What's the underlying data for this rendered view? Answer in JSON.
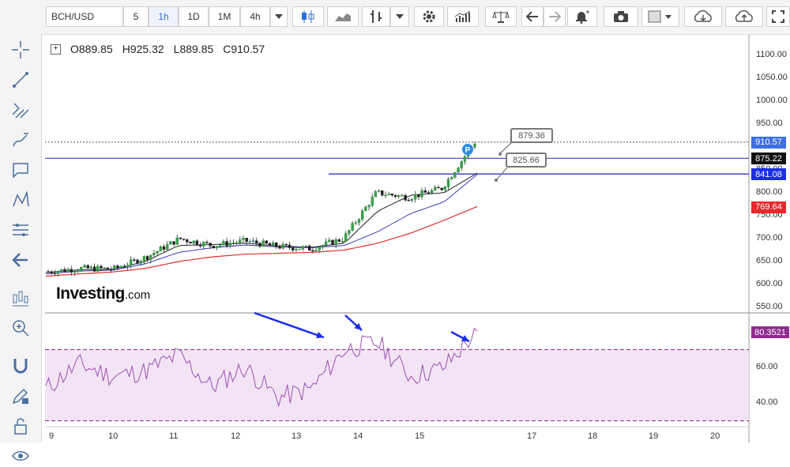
{
  "toolbar": {
    "symbol": "BCH/USD",
    "intervals": [
      "5",
      "1h",
      "1D",
      "1M",
      "4h"
    ],
    "active_interval": "1h",
    "icons": [
      "candlestick-icon",
      "area-chart-icon",
      "bar-chart-icon",
      "chevron-down-icon",
      "gear-icon",
      "indicators-icon",
      "balance-icon",
      "undo-icon",
      "redo-icon",
      "alert-bell-icon",
      "camera-icon",
      "color-picker-icon",
      "cloud-download-icon",
      "cloud-upload-icon",
      "fullscreen-icon"
    ]
  },
  "left_toolbar": {
    "icons": [
      "crosshair-icon",
      "trendline-icon",
      "fib-icon",
      "brush-icon",
      "comment-icon",
      "pattern-icon",
      "measure-icon",
      "back-arrow-icon",
      "indicators-icon",
      "zoom-icon",
      "magnet-icon",
      "pencil-lock-icon",
      "lock-icon",
      "eye-icon"
    ]
  },
  "ohlc": {
    "open": "O889.85",
    "high": "H925.32",
    "low": "L889.85",
    "close": "C910.57"
  },
  "logo": {
    "main": "Investing",
    "suffix": ".com"
  },
  "price_axis": {
    "labels": [
      "1100.00",
      "1050.00",
      "1000.00",
      "950.00",
      "900.00",
      "850.00",
      "800.00",
      "750.00",
      "700.00",
      "650.00",
      "600.00",
      "550.00"
    ],
    "values": [
      1100,
      1050,
      1000,
      950,
      900,
      850,
      800,
      750,
      700,
      650,
      600,
      550
    ],
    "tags": [
      {
        "label": "910.57",
        "value": 910.57,
        "color": "#3d6fe0"
      },
      {
        "label": "875.22",
        "value": 875.22,
        "color": "#111111"
      },
      {
        "label": "841.08",
        "value": 841.08,
        "color": "#1a2ee8"
      },
      {
        "label": "769.64",
        "value": 769.64,
        "color": "#e8262b"
      }
    ]
  },
  "rsi_axis": {
    "labels": [
      "60.00",
      "40.00"
    ],
    "values": [
      60,
      40
    ],
    "tag": {
      "label": "80.3521",
      "value": 80.3521,
      "color": "#8e2c8e"
    }
  },
  "time_axis": [
    "9",
    "10",
    "11",
    "12",
    "13",
    "14",
    "15",
    "17",
    "18",
    "19",
    "20"
  ],
  "annotations": {
    "callout_high": "879.36",
    "callout_low": "825.66",
    "marker": "P"
  },
  "chart_data": [
    {
      "type": "line",
      "title": "",
      "description_of_series": "BCH/USD 1h price (candles), short MA, medium MA, long MA",
      "x": [
        "9",
        "9.5",
        "10",
        "10.5",
        "11",
        "11.5",
        "12",
        "12.5",
        "13",
        "13.5",
        "14",
        "14.5",
        "15",
        "15.5"
      ],
      "series": [
        {
          "values": [
            628,
            635,
            634,
            660,
            700,
            685,
            695,
            683,
            678,
            700,
            800,
            790,
            810,
            910
          ]
        },
        {
          "values": [
            626,
            632,
            633,
            650,
            685,
            687,
            690,
            684,
            681,
            690,
            760,
            795,
            800,
            843
          ]
        },
        {
          "values": [
            623,
            629,
            631,
            645,
            670,
            680,
            686,
            682,
            680,
            685,
            715,
            755,
            780,
            840
          ]
        },
        {
          "values": [
            618,
            623,
            627,
            635,
            650,
            660,
            666,
            668,
            670,
            675,
            690,
            712,
            740,
            770
          ]
        }
      ],
      "series_colors": [
        "#222222",
        "#222222",
        "#3a3ab8",
        "#e03030"
      ],
      "ylim": [
        535,
        1120
      ],
      "horizontal_lines": [
        910.57,
        875.22,
        841.08
      ],
      "log": false
    },
    {
      "type": "line",
      "x": [
        "9",
        "9.5",
        "10",
        "10.5",
        "11",
        "11.5",
        "12",
        "12.5",
        "13",
        "13.5",
        "14",
        "14.5",
        "15",
        "15.5"
      ],
      "series": [
        {
          "values": [
            48,
            62,
            55,
            58,
            67,
            49,
            60,
            43,
            48,
            70,
            74,
            55,
            60,
            80.35
          ]
        }
      ],
      "series_colors": [
        "#9b4fb3"
      ],
      "ylim": [
        30,
        85
      ],
      "band": [
        30,
        70
      ],
      "log": false
    }
  ]
}
